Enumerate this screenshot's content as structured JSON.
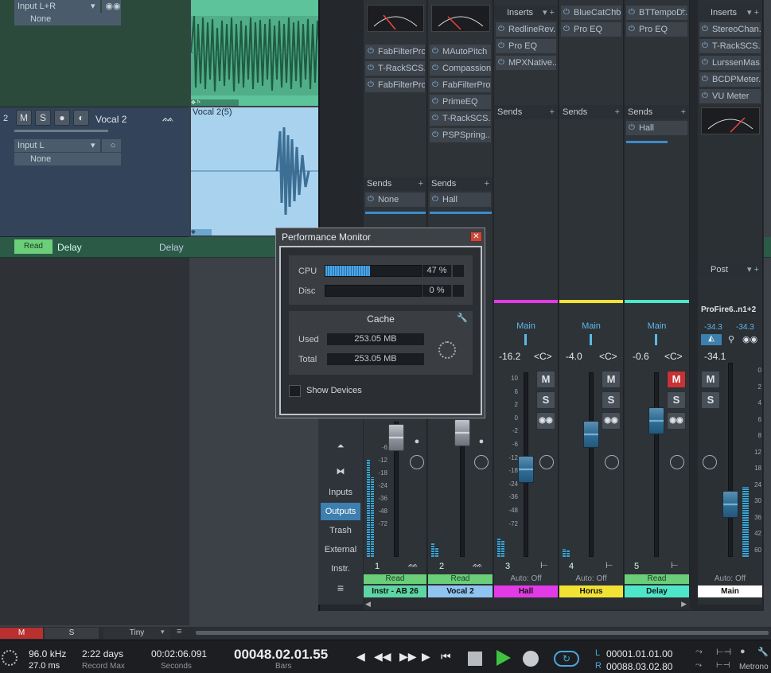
{
  "tracks": [
    {
      "input": "Input L+R",
      "output": "None"
    },
    {
      "number": "2",
      "mute": "M",
      "solo": "S",
      "name": "Vocal 2",
      "input": "Input L",
      "output": "None"
    }
  ],
  "events": {
    "vocal2_name": "Vocal 2(5)"
  },
  "automation_row": {
    "mode": "Read",
    "param": "Delay",
    "param_right": "Delay"
  },
  "inserts": {
    "ch1": [
      "FabFilterPro..",
      "T-RackSCS..",
      "FabFilterPro.."
    ],
    "ch2": [
      "MAutoPitch",
      "Compassion",
      "FabFilterPro..",
      "PrimeEQ",
      "T-RackSCS..",
      "PSPSpring.."
    ],
    "ch3_header": "Inserts",
    "ch3": [
      "RedlineRev..",
      "Pro EQ",
      "MPXNative.."
    ],
    "ch4": [
      "BlueCatCho..",
      "Pro EQ"
    ],
    "ch5": [
      "BTTempoD..",
      "Pro EQ"
    ],
    "main_header": "Inserts",
    "main": [
      "StereoChan..",
      "T-RackSCS..",
      "LurssenMas..",
      "BCDPMeter..",
      "VU Meter"
    ]
  },
  "sends": {
    "label": "Sends",
    "ch1": "None",
    "ch2": "Hall",
    "ch5": "Hall"
  },
  "main_post": "Post",
  "performance_monitor": {
    "title": "Performance Monitor",
    "cpu_label": "CPU",
    "cpu_value": "47 %",
    "cpu_fraction": 0.47,
    "disc_label": "Disc",
    "disc_value": "0 %",
    "cache_title": "Cache",
    "used_label": "Used",
    "used_value": "253.05 MB",
    "total_label": "Total",
    "total_value": "253.05 MB",
    "show_devices": "Show Devices"
  },
  "nav": {
    "inputs": "Inputs",
    "outputs": "Outputs",
    "trash": "Trash",
    "external": "External",
    "instr": "Instr."
  },
  "channels": [
    {
      "num": "1",
      "auto": "Read",
      "name": "Instr - AB 26",
      "color": "#5cd6a4"
    },
    {
      "num": "2",
      "auto": "Read",
      "name": "Vocal 2",
      "color": "#8fc3f0",
      "scale_top": "-6"
    },
    {
      "num": "3",
      "auto": "Auto: Off",
      "name": "Hall",
      "color": "#e23ae6",
      "route": "Main",
      "volume": "-16.2",
      "pan": "<C>"
    },
    {
      "num": "4",
      "auto": "Auto: Off",
      "name": "Horus",
      "color": "#f2e233",
      "route": "Main",
      "volume": "-4.0",
      "pan": "<C>"
    },
    {
      "num": "5",
      "auto": "Read",
      "name": "Delay",
      "color": "#4ee6c8",
      "route": "Main",
      "volume": "-0.6",
      "pan": "<C>"
    }
  ],
  "ch_buttons": {
    "mute": "M",
    "solo": "S"
  },
  "scale_labels": [
    "10",
    "6",
    "2",
    "0",
    "-2",
    "-6",
    "-12",
    "-18",
    "-24",
    "-36",
    "-48",
    "-72"
  ],
  "scale_short": [
    "-6",
    "-12",
    "-18",
    "-24",
    "-36",
    "-48",
    "-72"
  ],
  "main_channel": {
    "device": "ProFire6..n1+2",
    "peak_l": "-34.3",
    "peak_r": "-34.3",
    "volume": "-34.1",
    "auto": "Auto: Off",
    "name": "Main",
    "meter_scale": [
      "0",
      "2",
      "4",
      "6",
      "8",
      "12",
      "18",
      "24",
      "30",
      "36",
      "42",
      "60"
    ]
  },
  "bottom_bar": {
    "mute": "M",
    "solo": "S",
    "size": "Tiny"
  },
  "transport": {
    "sample_rate": "96.0 kHz",
    "latency": "27.0 ms",
    "record_max": "2:22 days",
    "record_max_label": "Record Max",
    "seconds": "00:02:06.091",
    "seconds_label": "Seconds",
    "bars": "00048.02.01.55",
    "bars_label": "Bars",
    "loop_l_label": "L",
    "loop_l": "00001.01.01.00",
    "loop_r_label": "R",
    "loop_r": "00088.03.02.80",
    "metronome": "Metrono"
  },
  "colors": {
    "accent": "#4aa6d8",
    "play": "#3fc23f",
    "mute_on": "#c83232",
    "track_green": "#2c4a3c"
  }
}
